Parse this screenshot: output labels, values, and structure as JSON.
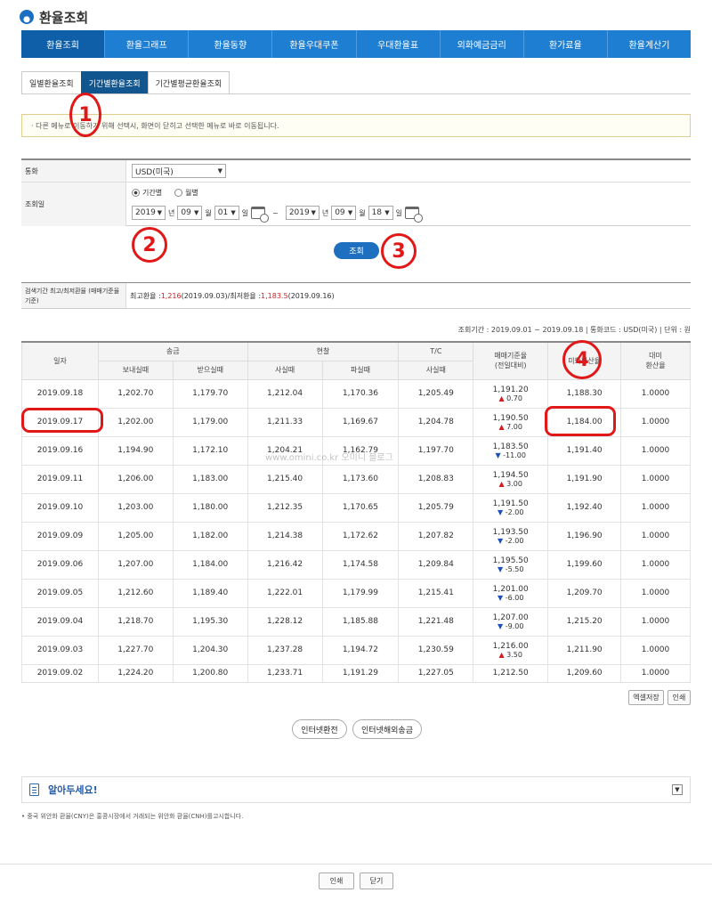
{
  "header": {
    "title": "환율조회"
  },
  "nav": [
    "환율조회",
    "환율그래프",
    "환율동향",
    "환율우대쿠폰",
    "우대환율표",
    "외화예금금리",
    "환가료율",
    "환율계산기"
  ],
  "subtabs": [
    "일별환율조회",
    "기간별환율조회",
    "기간별평균환율조회"
  ],
  "notice": "· 다른 메뉴로 이동하기 위해 선택시, 화면이 닫히고 선택한 메뉴로 바로 이동됩니다.",
  "form": {
    "currency_label": "통화",
    "currency_value": "USD(미국)",
    "period_label": "조회일",
    "radio_period": "기간별",
    "radio_month": "월별",
    "start": {
      "year": "2019",
      "month": "09",
      "day": "01"
    },
    "end": {
      "year": "2019",
      "month": "09",
      "day": "18"
    },
    "unit_year": "년",
    "unit_month": "월",
    "unit_day": "일",
    "tilde": "~",
    "query_button": "조회"
  },
  "summary": {
    "label": "검색기간 최고/최저환율 (매매기준율기준)",
    "high_label": "최고환율 : ",
    "high_value": "1,216",
    "high_date": "(2019.09.03)",
    "sep": " / ",
    "low_label": "최저환율 : ",
    "low_value": "1,183.5",
    "low_date": "(2019.09.16)"
  },
  "period_line": "조회기간 : 2019.09.01 ~ 2019.09.18  |  통화코드 : USD(미국)  |  단위 : 원",
  "table": {
    "h_date": "일자",
    "h_cash": "송금",
    "h_tt": "현찰",
    "h_tc": "T/C",
    "h_base": "매매기준율",
    "h_base_sub": "(전일대비)",
    "h_usd": "미화환산율",
    "h_usd_sub": "",
    "h_usd2": "대미",
    "h_usd2_sub": "환산율",
    "sub_send": "보내실때",
    "sub_recv": "받으실때",
    "sub_buy": "사실때",
    "sub_sell": "파실때",
    "sub_tc": "사실때",
    "rows": [
      {
        "date": "2019.09.18",
        "send": "1,202.70",
        "recv": "1,179.70",
        "buy": "1,212.04",
        "sell": "1,170.36",
        "tc": "1,205.49",
        "base": "1,191.20",
        "dir": "up",
        "chg": "0.70",
        "bk": "1,188.30",
        "usd": "1.0000"
      },
      {
        "date": "2019.09.17",
        "send": "1,202.00",
        "recv": "1,179.00",
        "buy": "1,211.33",
        "sell": "1,169.67",
        "tc": "1,204.78",
        "base": "1,190.50",
        "dir": "up",
        "chg": "7.00",
        "bk": "1,184.00",
        "usd": "1.0000"
      },
      {
        "date": "2019.09.16",
        "send": "1,194.90",
        "recv": "1,172.10",
        "buy": "1,204.21",
        "sell": "1,162.79",
        "tc": "1,197.70",
        "base": "1,183.50",
        "dir": "dn",
        "chg": "-11.00",
        "bk": "1,191.40",
        "usd": "1.0000"
      },
      {
        "date": "2019.09.11",
        "send": "1,206.00",
        "recv": "1,183.00",
        "buy": "1,215.40",
        "sell": "1,173.60",
        "tc": "1,208.83",
        "base": "1,194.50",
        "dir": "up",
        "chg": "3.00",
        "bk": "1,191.90",
        "usd": "1.0000"
      },
      {
        "date": "2019.09.10",
        "send": "1,203.00",
        "recv": "1,180.00",
        "buy": "1,212.35",
        "sell": "1,170.65",
        "tc": "1,205.79",
        "base": "1,191.50",
        "dir": "dn",
        "chg": "-2.00",
        "bk": "1,192.40",
        "usd": "1.0000"
      },
      {
        "date": "2019.09.09",
        "send": "1,205.00",
        "recv": "1,182.00",
        "buy": "1,214.38",
        "sell": "1,172.62",
        "tc": "1,207.82",
        "base": "1,193.50",
        "dir": "dn",
        "chg": "-2.00",
        "bk": "1,196.90",
        "usd": "1.0000"
      },
      {
        "date": "2019.09.06",
        "send": "1,207.00",
        "recv": "1,184.00",
        "buy": "1,216.42",
        "sell": "1,174.58",
        "tc": "1,209.84",
        "base": "1,195.50",
        "dir": "dn",
        "chg": "-5.50",
        "bk": "1,199.60",
        "usd": "1.0000"
      },
      {
        "date": "2019.09.05",
        "send": "1,212.60",
        "recv": "1,189.40",
        "buy": "1,222.01",
        "sell": "1,179.99",
        "tc": "1,215.41",
        "base": "1,201.00",
        "dir": "dn",
        "chg": "-6.00",
        "bk": "1,209.70",
        "usd": "1.0000"
      },
      {
        "date": "2019.09.04",
        "send": "1,218.70",
        "recv": "1,195.30",
        "buy": "1,228.12",
        "sell": "1,185.88",
        "tc": "1,221.48",
        "base": "1,207.00",
        "dir": "dn",
        "chg": "-9.00",
        "bk": "1,215.20",
        "usd": "1.0000"
      },
      {
        "date": "2019.09.03",
        "send": "1,227.70",
        "recv": "1,204.30",
        "buy": "1,237.28",
        "sell": "1,194.72",
        "tc": "1,230.59",
        "base": "1,216.00",
        "dir": "up",
        "chg": "3.50",
        "bk": "1,211.90",
        "usd": "1.0000"
      },
      {
        "date": "2019.09.02",
        "send": "1,224.20",
        "recv": "1,200.80",
        "buy": "1,233.71",
        "sell": "1,191.29",
        "tc": "1,227.05",
        "base": "1,212.50",
        "dir": "",
        "chg": "",
        "bk": "1,209.60",
        "usd": "1.0000"
      }
    ]
  },
  "buttons": {
    "excel": "엑셀저장",
    "print": "인쇄",
    "remit": "인터넷환전",
    "overseas": "인터넷해외송금"
  },
  "info": {
    "title": "알아두세요!",
    "note": "• 중국 위안화 환율(CNY)은 홍콩시장에서 거래되는 위안화 환율(CNH)를고시합니다."
  },
  "footer": {
    "print": "인쇄",
    "close": "닫기"
  },
  "watermark": "www.omini.co.kr 오미니 블로그",
  "annotations": [
    "1",
    "2",
    "3",
    "4"
  ]
}
